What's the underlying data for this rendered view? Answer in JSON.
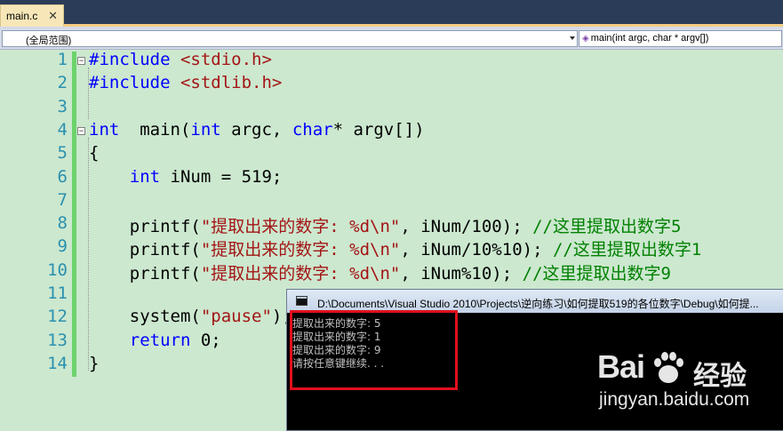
{
  "tab": {
    "label": "main.c",
    "close_glyph": "✕"
  },
  "nav": {
    "scope": "(全局范围)",
    "function": "main(int argc, char * argv[])"
  },
  "code_lines": [
    {
      "num": "1",
      "html_tokens": [
        [
          "pp",
          "#include "
        ],
        [
          "inc",
          "<stdio.h>"
        ]
      ]
    },
    {
      "num": "2",
      "html_tokens": [
        [
          "pp",
          "#include "
        ],
        [
          "inc",
          "<stdlib.h>"
        ]
      ]
    },
    {
      "num": "3",
      "html_tokens": []
    },
    {
      "num": "4",
      "html_tokens": [
        [
          "kw",
          "int"
        ],
        [
          "",
          "  main("
        ],
        [
          "kw",
          "int"
        ],
        [
          "",
          " argc, "
        ],
        [
          "kw",
          "char"
        ],
        [
          "",
          "* argv[])"
        ]
      ]
    },
    {
      "num": "5",
      "html_tokens": [
        [
          "",
          "{"
        ]
      ]
    },
    {
      "num": "6",
      "html_tokens": [
        [
          "",
          "    "
        ],
        [
          "kw",
          "int"
        ],
        [
          "",
          " iNum = 519;"
        ]
      ]
    },
    {
      "num": "7",
      "html_tokens": []
    },
    {
      "num": "8",
      "html_tokens": [
        [
          "",
          "    printf("
        ],
        [
          "str",
          "\"提取出来的数字: %d\\n\""
        ],
        [
          "",
          ", iNum/100); "
        ],
        [
          "cmt",
          "//这里提取出数字5"
        ]
      ]
    },
    {
      "num": "9",
      "html_tokens": [
        [
          "",
          "    printf("
        ],
        [
          "str",
          "\"提取出来的数字: %d\\n\""
        ],
        [
          "",
          ", iNum/10%10); "
        ],
        [
          "cmt",
          "//这里提取出数字1"
        ]
      ]
    },
    {
      "num": "10",
      "html_tokens": [
        [
          "",
          "    printf("
        ],
        [
          "str",
          "\"提取出来的数字: %d\\n\""
        ],
        [
          "",
          ", iNum%10); "
        ],
        [
          "cmt",
          "//这里提取出数字9"
        ]
      ]
    },
    {
      "num": "11",
      "html_tokens": []
    },
    {
      "num": "12",
      "html_tokens": [
        [
          "",
          "    system("
        ],
        [
          "str",
          "\"pause\""
        ],
        [
          "",
          ");"
        ]
      ]
    },
    {
      "num": "13",
      "html_tokens": [
        [
          "",
          "    "
        ],
        [
          "kw",
          "return"
        ],
        [
          "",
          " 0;"
        ]
      ]
    },
    {
      "num": "14",
      "html_tokens": [
        [
          "",
          "}"
        ]
      ]
    }
  ],
  "console": {
    "title": "D:\\Documents\\Visual Studio 2010\\Projects\\逆向练习\\如何提取519的各位数字\\Debug\\如何提...",
    "lines": [
      "提取出来的数字: 5",
      "提取出来的数字: 1",
      "提取出来的数字: 9",
      "请按任意键继续. . ."
    ]
  },
  "watermark": {
    "brand": "Bai",
    "brand_suffix": "经验",
    "url": "jingyan.baidu.com"
  },
  "colors": {
    "editor_bg": "#cce8cf",
    "keyword": "#0000ff",
    "string": "#a31515",
    "comment": "#008000",
    "line_number": "#2b91af",
    "highlight_border": "#e0101c"
  }
}
